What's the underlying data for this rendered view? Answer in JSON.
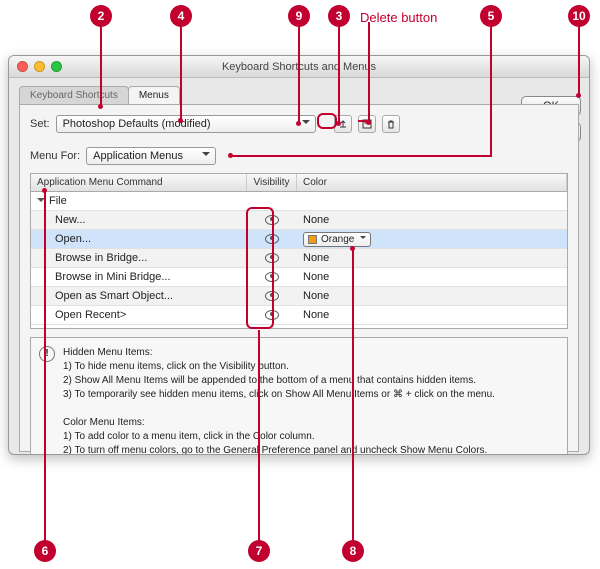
{
  "callouts": {
    "n2": "2",
    "n3": "3",
    "n4": "4",
    "n5": "5",
    "n6": "6",
    "n7": "7",
    "n8": "8",
    "n9": "9",
    "n10": "10",
    "delete_label": "Delete button"
  },
  "window": {
    "title": "Keyboard Shortcuts and Menus",
    "tabs": {
      "shortcuts": "Keyboard Shortcuts",
      "menus": "Menus"
    },
    "buttons": {
      "ok": "OK",
      "cancel": "Cancel"
    },
    "set": {
      "label": "Set:",
      "value": "Photoshop Defaults (modified)"
    },
    "menu_for": {
      "label": "Menu For:",
      "value": "Application Menus"
    },
    "table": {
      "headers": {
        "cmd": "Application Menu Command",
        "vis": "Visibility",
        "color": "Color"
      },
      "file_row": "File",
      "rows": [
        {
          "label": "New...",
          "color": "None"
        },
        {
          "label": "Open...",
          "color": "Orange",
          "selected": true
        },
        {
          "label": "Browse in Bridge...",
          "color": "None"
        },
        {
          "label": "Browse in Mini Bridge...",
          "color": "None"
        },
        {
          "label": "Open as Smart Object...",
          "color": "None"
        },
        {
          "label": "Open Recent>",
          "color": "None"
        }
      ]
    },
    "help": {
      "hidden_title": "Hidden Menu Items:",
      "hidden_1": "1) To hide menu items, click on the Visibility button.",
      "hidden_2": "2) Show All Menu Items will be appended to the bottom of a menu that contains hidden items.",
      "hidden_3": "3) To temporarily see hidden menu items, click on Show All Menu Items or ⌘ + click on the menu.",
      "color_title": "Color Menu Items:",
      "color_1": "1) To add color to a menu item, click in the Color column.",
      "color_2": "2) To turn off menu colors, go to the General Preference panel and uncheck Show Menu Colors."
    }
  }
}
